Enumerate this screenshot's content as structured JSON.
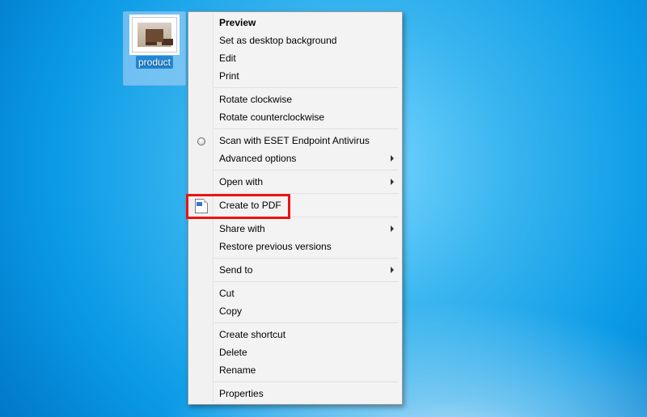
{
  "desktop": {
    "icon": {
      "label": "product"
    }
  },
  "menu": {
    "items": {
      "preview": "Preview",
      "set_bg": "Set as desktop background",
      "edit": "Edit",
      "print": "Print",
      "rotate_cw": "Rotate clockwise",
      "rotate_ccw": "Rotate counterclockwise",
      "scan_eset": "Scan with ESET Endpoint Antivirus",
      "adv_opts": "Advanced options",
      "open_with": "Open with",
      "create_pdf": "Create to PDF",
      "share_with": "Share with",
      "restore_prev": "Restore previous versions",
      "send_to": "Send to",
      "cut": "Cut",
      "copy": "Copy",
      "create_shortcut": "Create shortcut",
      "delete": "Delete",
      "rename": "Rename",
      "properties": "Properties"
    }
  }
}
